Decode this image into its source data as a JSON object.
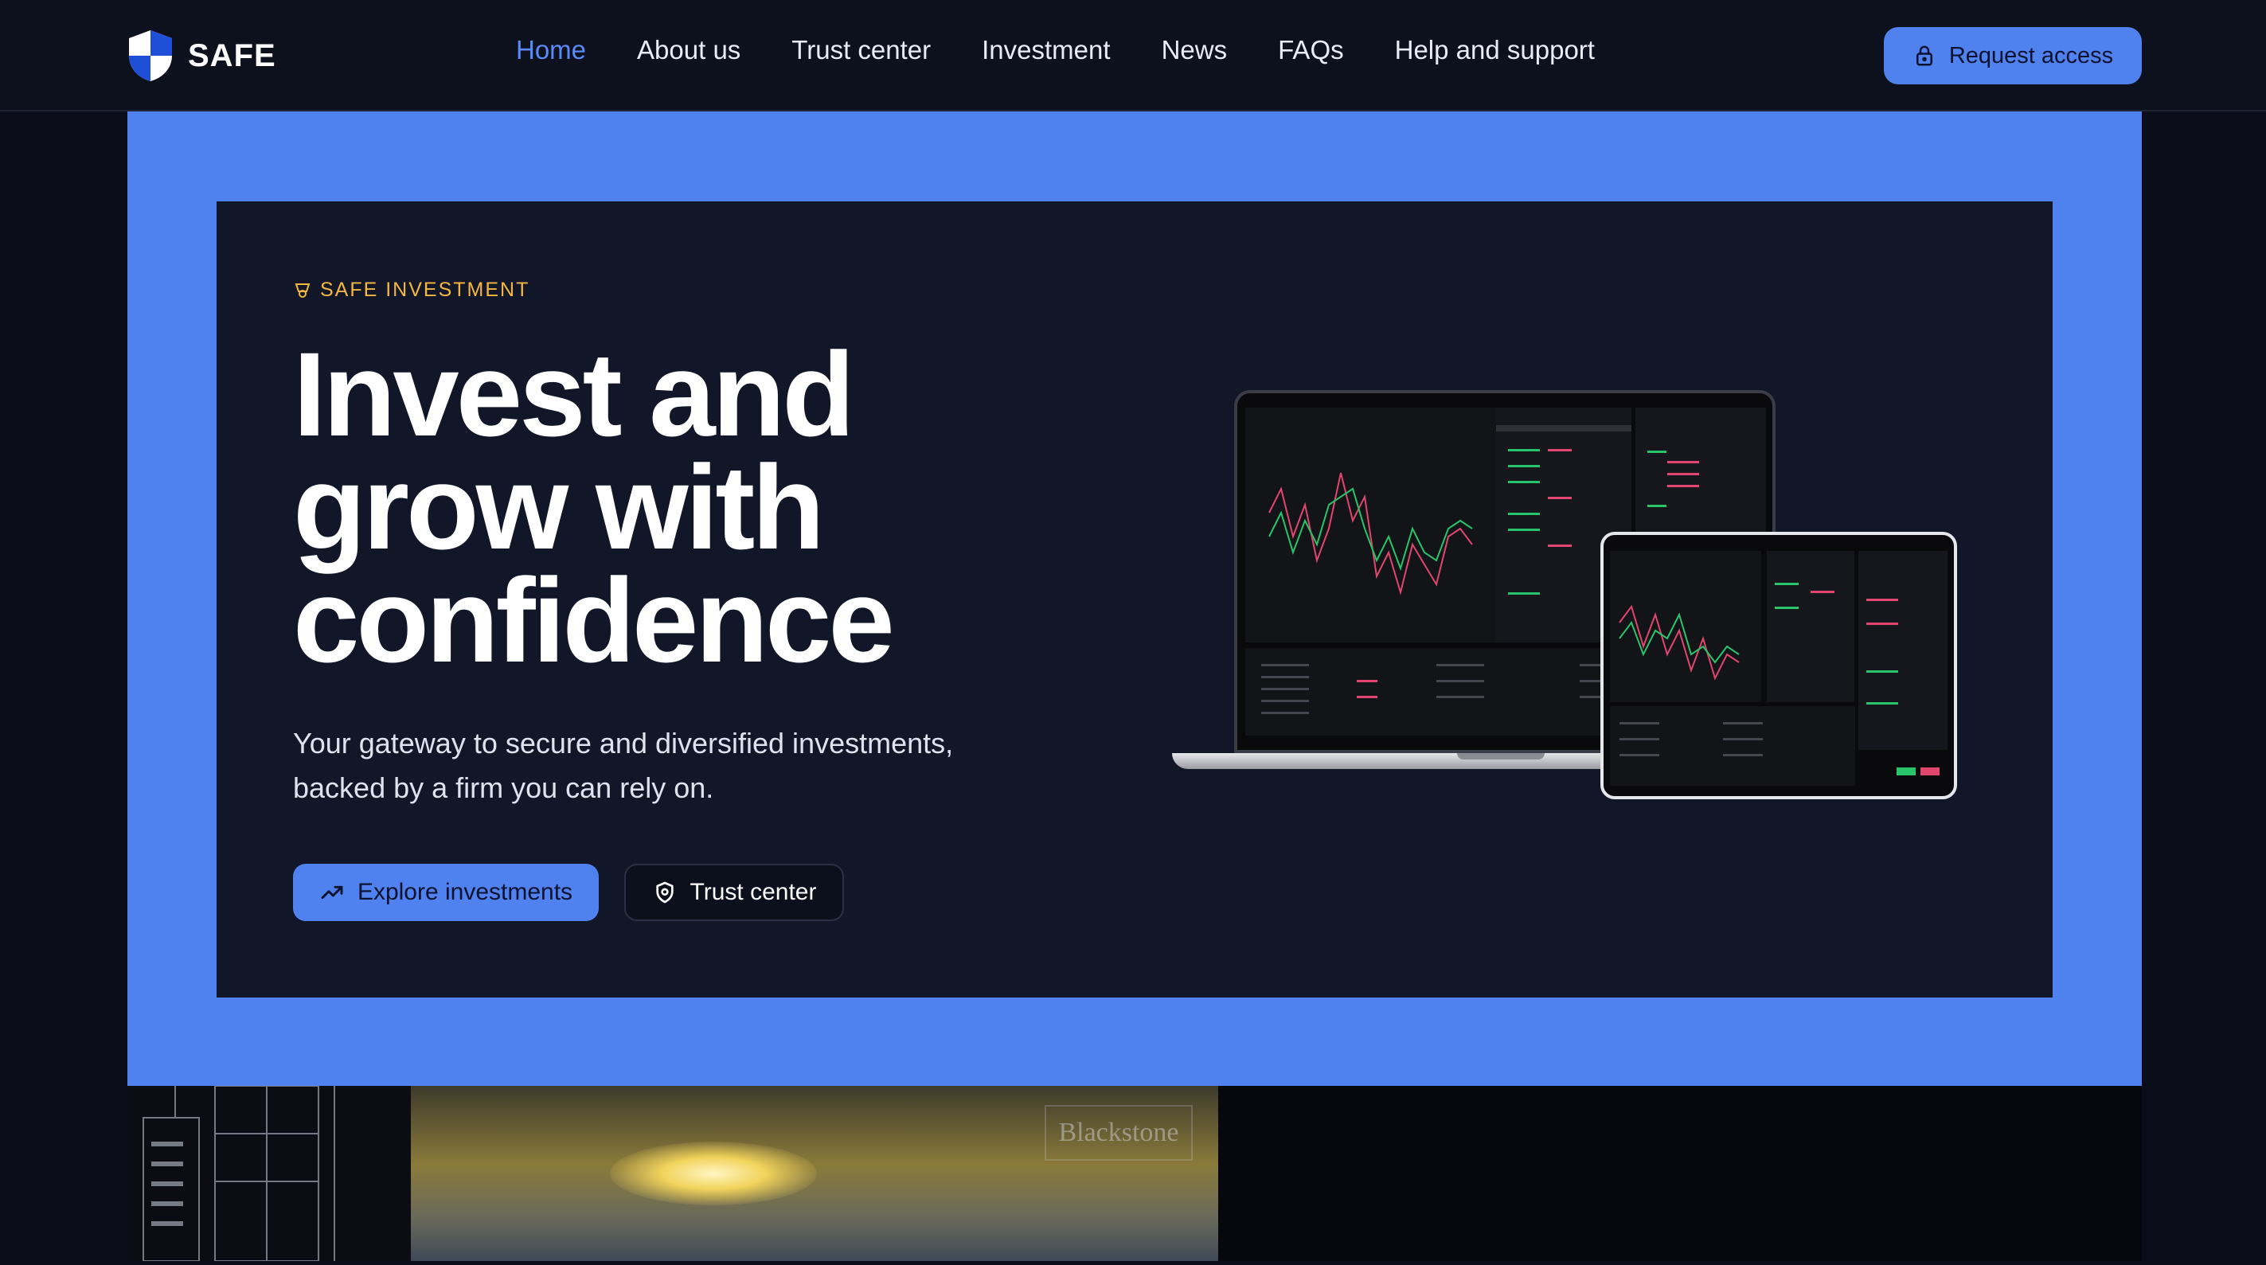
{
  "brand": {
    "name": "SAFE"
  },
  "nav": {
    "links": [
      {
        "label": "Home",
        "active": true
      },
      {
        "label": "About us"
      },
      {
        "label": "Trust center"
      },
      {
        "label": "Investment"
      },
      {
        "label": "News"
      },
      {
        "label": "FAQs"
      },
      {
        "label": "Help and support"
      }
    ],
    "cta": "Request access"
  },
  "hero": {
    "eyebrow": "SAFE INVESTMENT",
    "headline_lines": [
      "Invest and",
      "grow with",
      "confidence"
    ],
    "subtext_lines": [
      "Your gateway to secure and diversified investments,",
      "backed by a firm you can rely on."
    ],
    "primary_button": "Explore investments",
    "secondary_button": "Trust center"
  },
  "partner_logo": "Blackstone",
  "colors": {
    "accent": "#4f82ee",
    "nav_active": "#5b8af7",
    "eyebrow": "#f4b740",
    "card_bg": "#121629",
    "page_bg": "#0b0e1a"
  },
  "icons": {
    "logo": "shield-logo-icon",
    "cta": "lock-icon",
    "eyebrow": "badge-icon",
    "primary_button": "trending-up-icon",
    "secondary_button": "shield-check-icon"
  }
}
